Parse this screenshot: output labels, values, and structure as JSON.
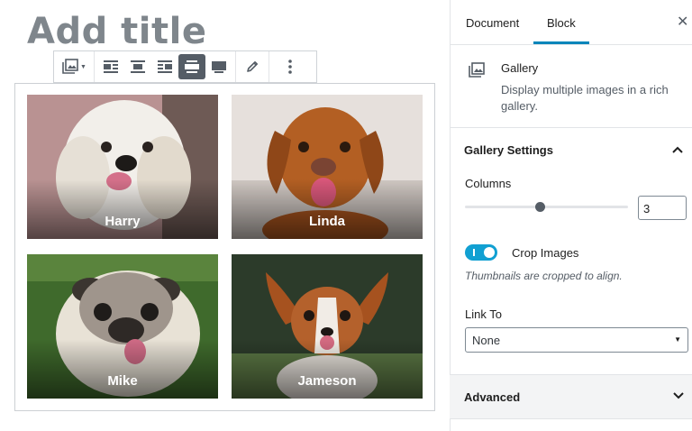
{
  "editor": {
    "title_placeholder": "Add title",
    "gallery": [
      {
        "caption": "Harry"
      },
      {
        "caption": "Linda"
      },
      {
        "caption": "Mike"
      },
      {
        "caption": "Jameson"
      }
    ]
  },
  "toolbar": {
    "buttons": [
      {
        "icon": "gallery-block-icon",
        "has_dropdown": true
      },
      {
        "icon": "align-left-icon"
      },
      {
        "icon": "align-center-icon"
      },
      {
        "icon": "align-right-icon"
      },
      {
        "icon": "align-wide-icon",
        "active": true
      },
      {
        "icon": "align-full-icon"
      },
      {
        "icon": "edit-pencil-icon"
      },
      {
        "icon": "more-options-icon"
      }
    ]
  },
  "sidebar": {
    "tabs": [
      "Document",
      "Block"
    ],
    "active_tab": "Block",
    "close_icon": "close-icon",
    "block": {
      "name": "Gallery",
      "description": "Display multiple images in a rich gallery."
    },
    "gallery_settings": {
      "title": "Gallery Settings",
      "columns_label": "Columns",
      "columns_value": "3",
      "columns_slider_fraction": 0.46,
      "crop_label": "Crop Images",
      "crop_enabled": true,
      "crop_help": "Thumbnails are cropped to align.",
      "link_to_label": "Link To",
      "link_to_value": "None"
    },
    "advanced": {
      "title": "Advanced"
    }
  },
  "colors": {
    "accent": "#0085ba",
    "toggle_on": "#11a0d2",
    "toolbar_active": "#555d66"
  }
}
